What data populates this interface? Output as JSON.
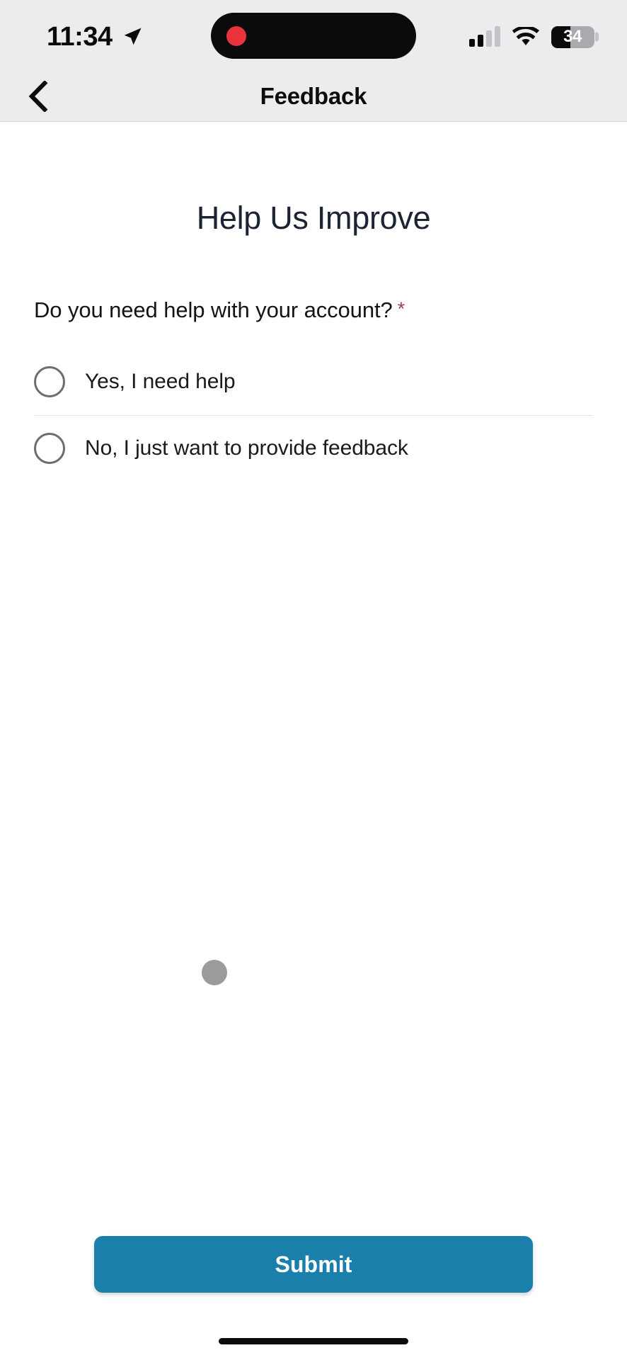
{
  "status_bar": {
    "time": "11:34",
    "location_icon": "location-arrow-icon",
    "recording_indicator": "recording-dot",
    "signal_icon": "cellular-signal-icon",
    "signal_bars_filled": 2,
    "signal_bars_total": 4,
    "wifi_icon": "wifi-icon",
    "battery_icon": "battery-icon",
    "battery_percent": "34"
  },
  "nav_bar": {
    "back_icon": "chevron-left-icon",
    "title": "Feedback"
  },
  "main": {
    "heading": "Help Us Improve",
    "question": {
      "text": "Do you need help with your account?",
      "required_marker": "*",
      "required_color": "#a14152"
    },
    "options": [
      {
        "label": "Yes, I need help",
        "selected": false
      },
      {
        "label": "No, I just want to provide feedback",
        "selected": false
      }
    ],
    "loading_indicator": "loading-dot"
  },
  "footer": {
    "submit_label": "Submit",
    "submit_color": "#1a7fab",
    "home_indicator": "home-indicator"
  }
}
